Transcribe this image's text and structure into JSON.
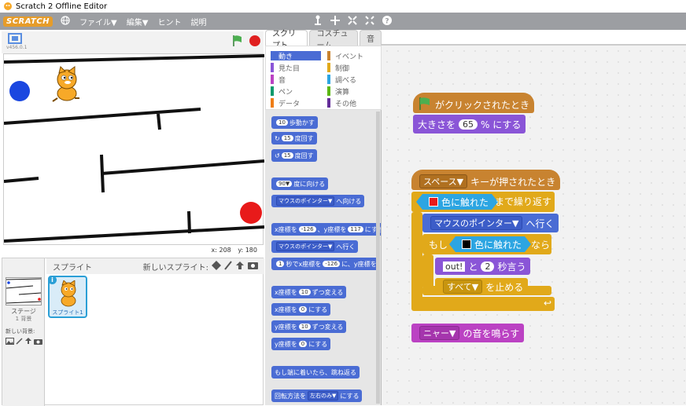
{
  "window": {
    "title": "Scratch 2 Offline Editor"
  },
  "menubar": {
    "logo": "SCRATCH",
    "items": [
      "ファイル▼",
      "編集▼",
      "ヒント",
      "説明"
    ]
  },
  "stage": {
    "version": "v456.0.1",
    "coords": {
      "x_label": "x:",
      "x_value": "208",
      "y_label": "y:",
      "y_value": "180"
    }
  },
  "sprites": {
    "header_label": "スプライト",
    "new_sprite_label": "新しいスプライト:",
    "stage_label": "ステージ",
    "stage_backdrops": "1 背景",
    "new_backdrop_label": "新しい背景:",
    "sprite1_label": "スプライト1"
  },
  "tabs": [
    "スクリプト",
    "コスチューム",
    "音"
  ],
  "categories": [
    {
      "label": "動き",
      "color": "#4a6cd4",
      "active": true
    },
    {
      "label": "見た目",
      "color": "#8a55d7"
    },
    {
      "label": "音",
      "color": "#bb42c3"
    },
    {
      "label": "ペン",
      "color": "#0e9a6c"
    },
    {
      "label": "データ",
      "color": "#ee7d16"
    },
    {
      "label": "イベント",
      "color": "#c88330"
    },
    {
      "label": "制御",
      "color": "#e1a91a"
    },
    {
      "label": "調べる",
      "color": "#2ca5e2"
    },
    {
      "label": "演算",
      "color": "#5cb712"
    },
    {
      "label": "その他",
      "color": "#632d99"
    }
  ],
  "palette": {
    "move": {
      "n": "10",
      "t": "歩動かす"
    },
    "turn_right": {
      "n": "15",
      "t": "度回す"
    },
    "turn_left": {
      "n": "15",
      "t": "度回す"
    },
    "point_dir": {
      "n": "90▼",
      "t": "度に向ける"
    },
    "point_towards": {
      "dd": "マウスのポインター▼",
      "t": "へ向ける"
    },
    "goto_xy": {
      "a": "x座標を",
      "x": "-126",
      "b": "、y座標を",
      "y": "117",
      "c": "にする"
    },
    "goto": {
      "dd": "マウスのポインター▼",
      "t": "へ行く"
    },
    "glide": {
      "n": "1",
      "a": "秒でx座標を",
      "x": "-126",
      "b": "に、y座標を"
    },
    "change_x": {
      "a": "x座標を",
      "n": "10",
      "b": "ずつ変える"
    },
    "set_x": {
      "a": "x座標を",
      "n": "0",
      "b": "にする"
    },
    "change_y": {
      "a": "y座標を",
      "n": "10",
      "b": "ずつ変える"
    },
    "set_y": {
      "a": "y座標を",
      "n": "0",
      "b": "にする"
    },
    "bounce": "もし端に着いたら、跳ね返る",
    "rotation": {
      "a": "回転方法を",
      "dd": "左右のみ▼",
      "b": "にする"
    }
  },
  "scripts": {
    "flag_hat": "がクリックされたとき",
    "size": {
      "a": "大きさを",
      "n": "65",
      "b": "% にする"
    },
    "key_hat": {
      "dd": "スペース▼",
      "t": "キーが押されたとき"
    },
    "repeat_until": {
      "b": "まで繰り返す"
    },
    "touch_red": "色に触れた",
    "goto_mouse": {
      "dd": "マウスのポインター▼",
      "t": "へ行く"
    },
    "if": {
      "a": "もし",
      "b": "なら"
    },
    "touch_black": "色に触れた",
    "say": {
      "txt": "out!",
      "a": "と",
      "n": "2",
      "b": "秒言う"
    },
    "stop": {
      "dd": "すべて▼",
      "t": "を止める"
    },
    "sound": {
      "dd": "ニャー▼",
      "t": "の音を鳴らす"
    }
  }
}
